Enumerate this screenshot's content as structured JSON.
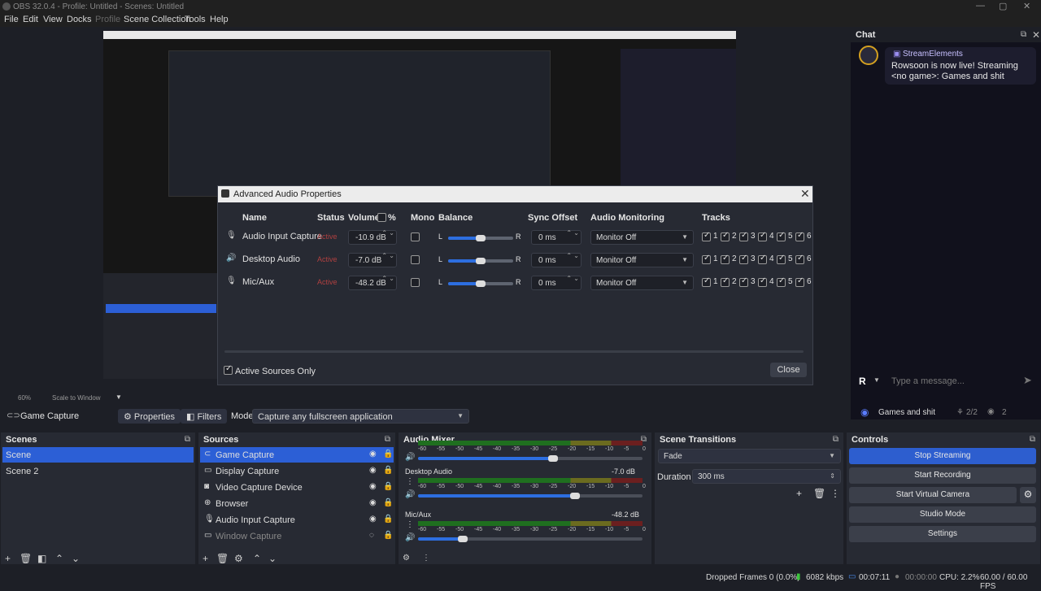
{
  "window": {
    "title": "OBS 32.0.4 - Profile: Untitled - Scenes: Untitled",
    "min": "—",
    "max": "▢",
    "close": "✕"
  },
  "menu": [
    "File",
    "Edit",
    "View",
    "Docks",
    "Profile",
    "Scene Collection",
    "Tools",
    "Help"
  ],
  "chat": {
    "title": "Chat",
    "user": "StreamElements",
    "message": "Rowsoon is now live! Streaming <no game>: Games and shit",
    "avatar_letter": "R",
    "placeholder": "Type a message...",
    "stream_title": "Games and shit",
    "mods": "2/2",
    "viewers": "2"
  },
  "dialog": {
    "title": "Advanced Audio Properties",
    "close_label": "Close",
    "active_only": "Active Sources Only",
    "columns": {
      "name": "Name",
      "status": "Status",
      "volume": "Volume",
      "pct": "%",
      "mono": "Mono",
      "balance": "Balance",
      "sync": "Sync Offset",
      "monitoring": "Audio Monitoring",
      "tracks": "Tracks"
    },
    "balance_l": "L",
    "balance_r": "R",
    "rows": [
      {
        "name": "Audio Input Capture",
        "status": "Active",
        "volume": "-10.9 dB",
        "sync": "0 ms",
        "monitoring": "Monitor Off",
        "balance": 0.5
      },
      {
        "name": "Desktop Audio",
        "status": "Active",
        "volume": "-7.0 dB",
        "sync": "0 ms",
        "monitoring": "Monitor Off",
        "balance": 0.5
      },
      {
        "name": "Mic/Aux",
        "status": "Active",
        "volume": "-48.2 dB",
        "sync": "0 ms",
        "monitoring": "Monitor Off",
        "balance": 0.5
      }
    ],
    "track_nums": [
      "1",
      "2",
      "3",
      "4",
      "5",
      "6"
    ]
  },
  "preview": {
    "zoom": "60%",
    "scale_label": "Scale to Window"
  },
  "source_toolbar": {
    "source": "Game Capture",
    "properties": "Properties",
    "filters": "Filters",
    "mode_label": "Mode",
    "mode_value": "Capture any fullscreen application"
  },
  "scenes": {
    "title": "Scenes",
    "items": [
      "Scene",
      "Scene 2"
    ]
  },
  "sources": {
    "title": "Sources",
    "items": [
      "Game Capture",
      "Display Capture",
      "Video Capture Device",
      "Browser",
      "Audio Input Capture",
      "Window Capture"
    ]
  },
  "mixer": {
    "title": "Audio Mixer",
    "ticks": [
      "-60",
      "-55",
      "-50",
      "-45",
      "-40",
      "-35",
      "-30",
      "-25",
      "-20",
      "-15",
      "-10",
      "-5",
      "0"
    ],
    "channels": [
      {
        "name": "Desktop Audio",
        "db": "-7.0 dB",
        "volume_pct": 0.7
      },
      {
        "name": "Mic/Aux",
        "db": "-48.2 dB",
        "volume_pct": 0.2
      }
    ],
    "top_volume_pct": 0.6
  },
  "transitions": {
    "title": "Scene Transitions",
    "value": "Fade",
    "duration_label": "Duration",
    "duration_value": "300 ms"
  },
  "controls": {
    "title": "Controls",
    "buttons": [
      "Stop Streaming",
      "Start Recording",
      "Start Virtual Camera",
      "Studio Mode",
      "Settings"
    ]
  },
  "status": {
    "dropped": "Dropped Frames 0 (0.0%)",
    "bitrate": "6082 kbps",
    "live_time": "00:07:11",
    "rec_time": "00:00:00",
    "cpu": "CPU: 2.2%",
    "fps": "60.00 / 60.00 FPS"
  }
}
